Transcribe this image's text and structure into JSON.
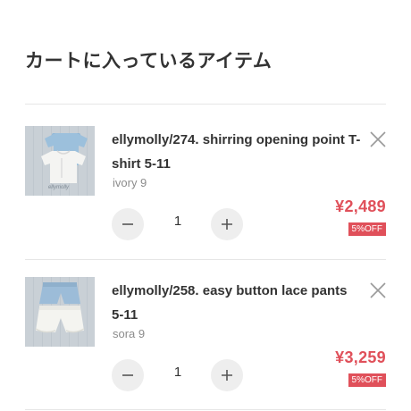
{
  "header": {
    "title": "カートに入っているアイテム"
  },
  "items": [
    {
      "name": "ellymolly/274. shirring opening point T-shirt 5-11",
      "variant": "ivory 9",
      "quantity": "1",
      "price": "¥2,489",
      "discount": "5%OFF",
      "image_icon": "product-photo-shirts"
    },
    {
      "name": "ellymolly/258. easy button lace pants 5-11",
      "variant": "sora 9",
      "quantity": "1",
      "price": "¥3,259",
      "discount": "5%OFF",
      "image_icon": "product-photo-pants"
    }
  ],
  "colors": {
    "price": "#e0505a",
    "text": "#333333",
    "muted": "#8c8c8c",
    "button_bg": "#eeeeee",
    "divider": "#e6e6e6"
  }
}
